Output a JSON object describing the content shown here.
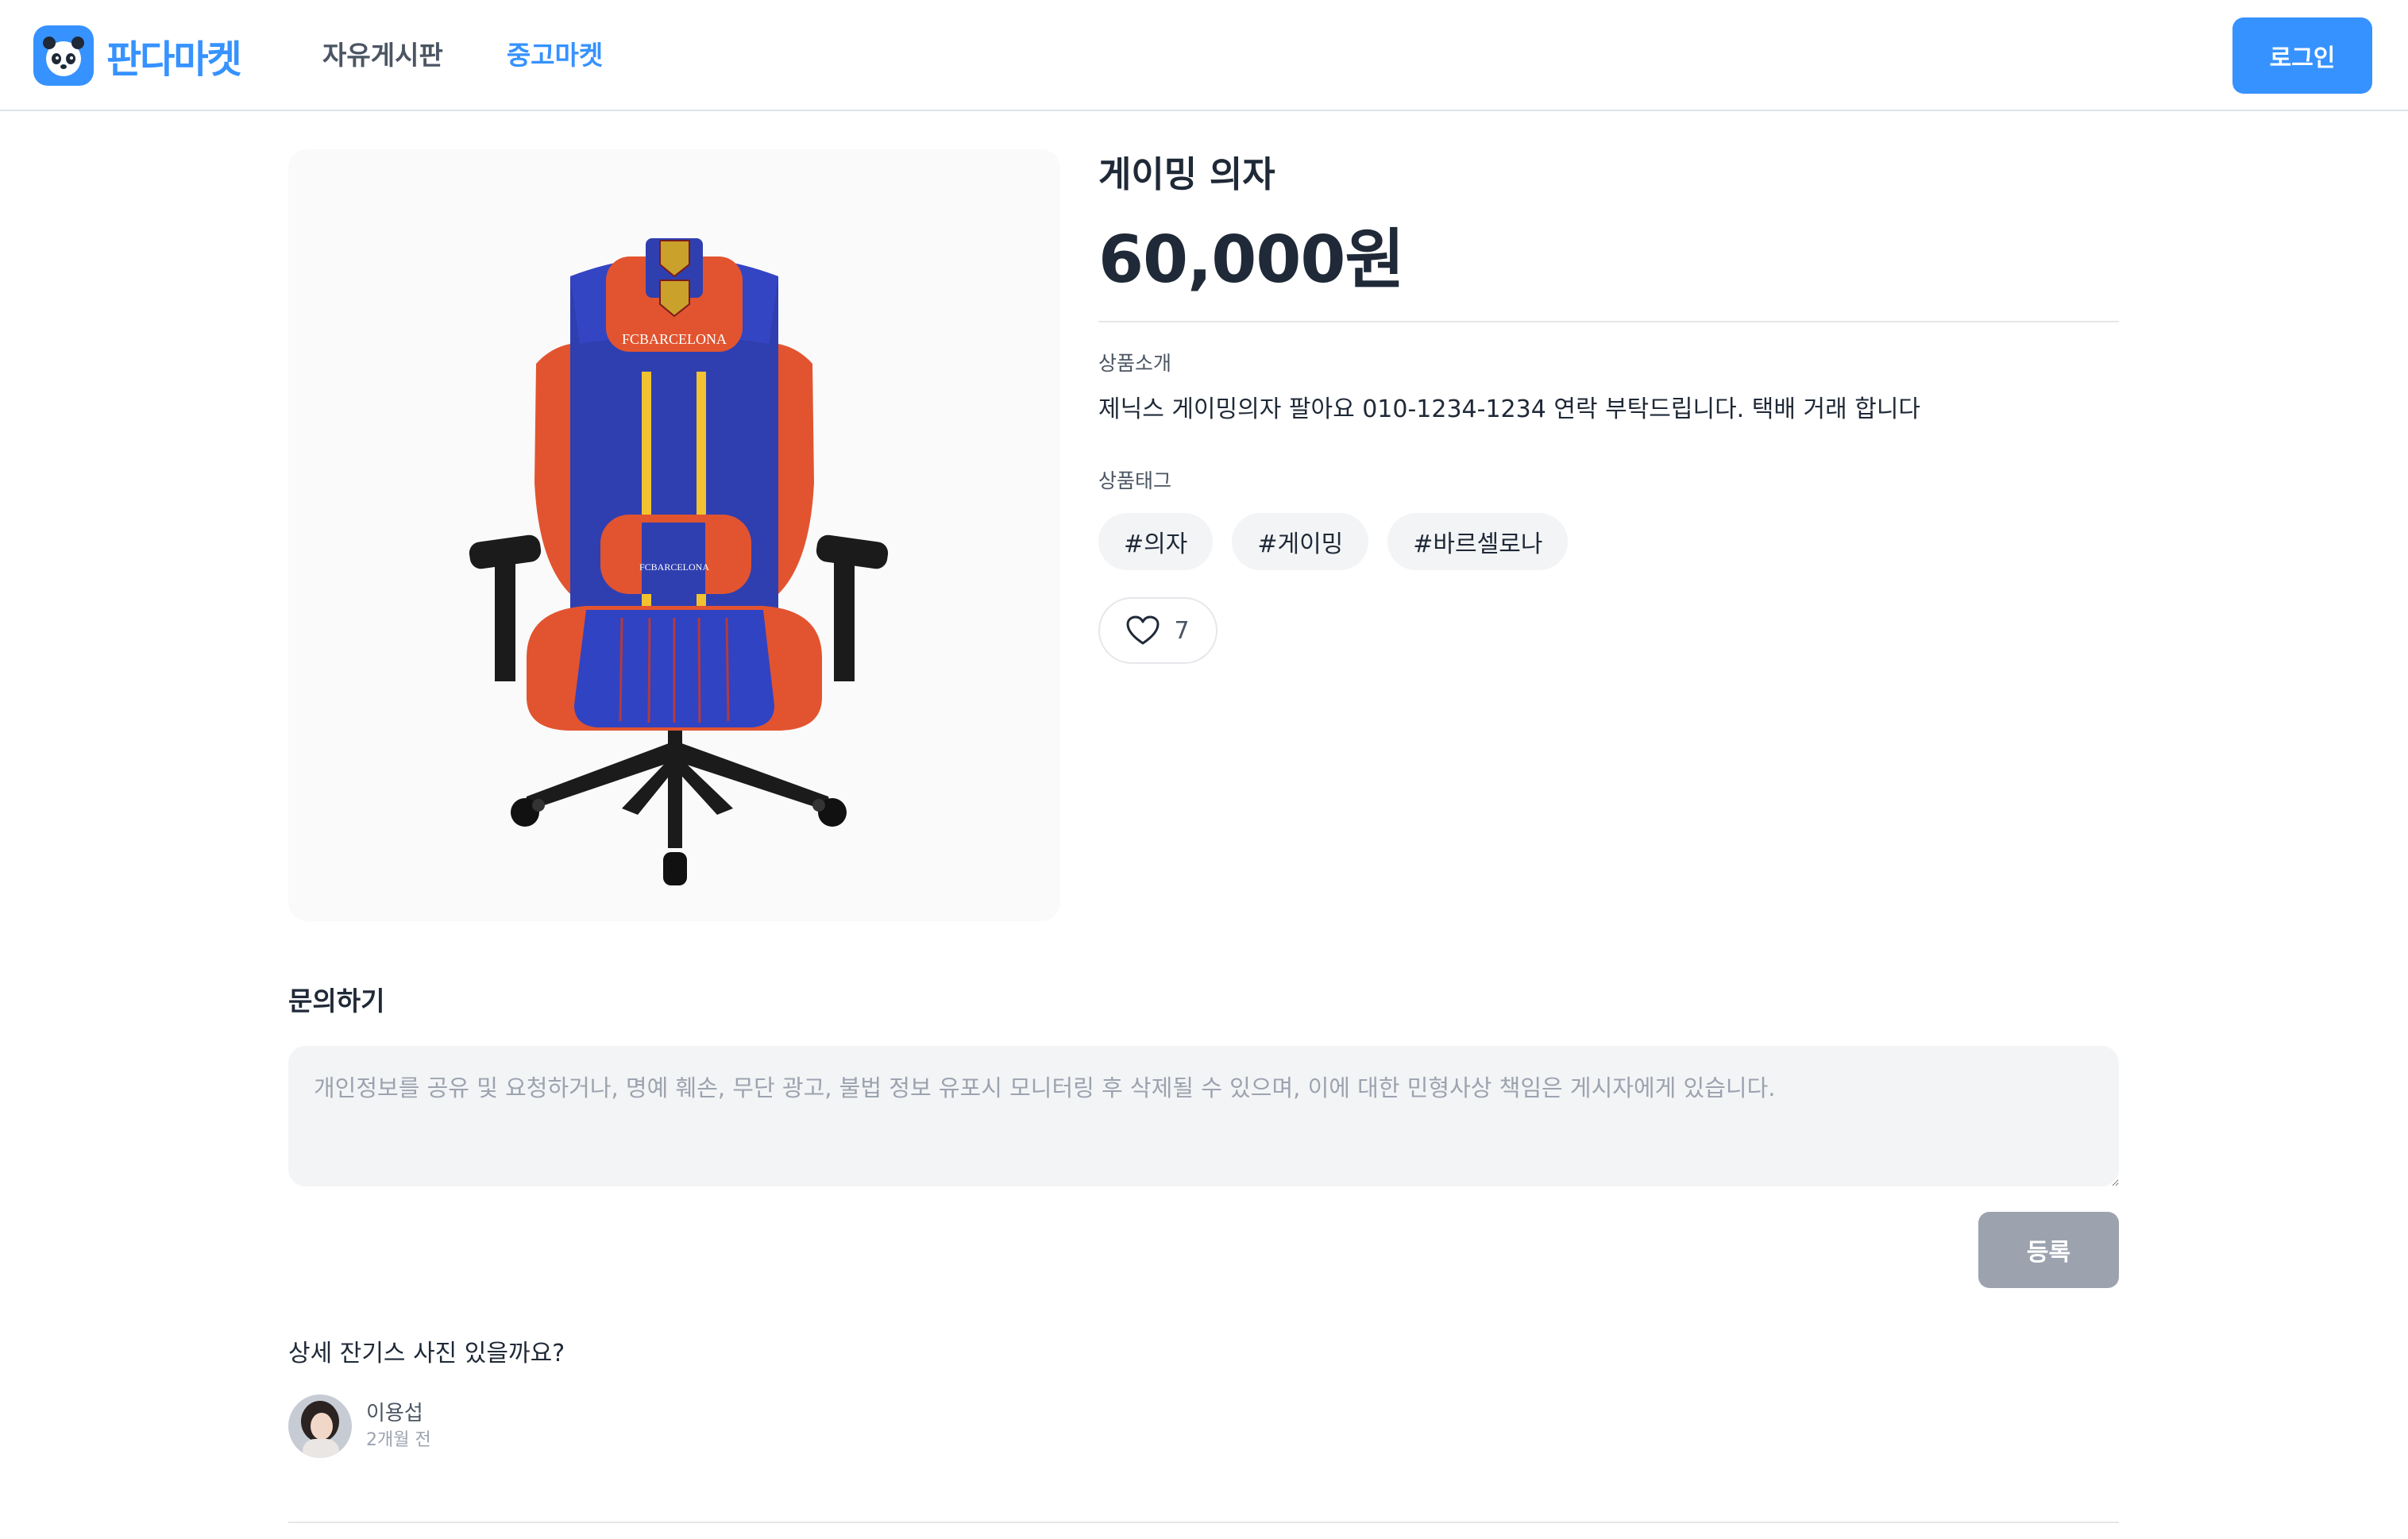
{
  "header": {
    "logo_text": "판다마켓",
    "nav": [
      {
        "label": "자유게시판",
        "active": false
      },
      {
        "label": "중고마켓",
        "active": true
      }
    ],
    "login_label": "로그인"
  },
  "product": {
    "image_icon": "gaming-chair-image",
    "title": "게이밍 의자",
    "price": "60,000원",
    "description_label": "상품소개",
    "description": "제닉스 게이밍의자 팔아요 010-1234-1234 연락 부탁드립니다. 택배 거래 합니다",
    "tags_label": "상품태그",
    "tags": [
      "#의자",
      "#게이밍",
      "#바르셀로나"
    ],
    "chair_print": "FCBARCELONA",
    "favorite_count": "7"
  },
  "inquiry": {
    "title": "문의하기",
    "placeholder": "개인정보를 공유 및 요청하거나, 명예 훼손, 무단 광고, 불법 정보 유포시 모니터링 후 삭제될 수 있으며, 이에 대한 민형사상 책임은 게시자에게 있습니다.",
    "submit_label": "등록"
  },
  "comments": [
    {
      "text": "상세 잔기스 사진 있을까요?",
      "author": "이용섭",
      "time": "2개월 전"
    }
  ],
  "colors": {
    "brand": "#3692ff",
    "disabled": "#9ca3af",
    "chair_blue": "#2f3fb0",
    "chair_red": "#e2542f",
    "chair_stripe": "#f2c230"
  }
}
